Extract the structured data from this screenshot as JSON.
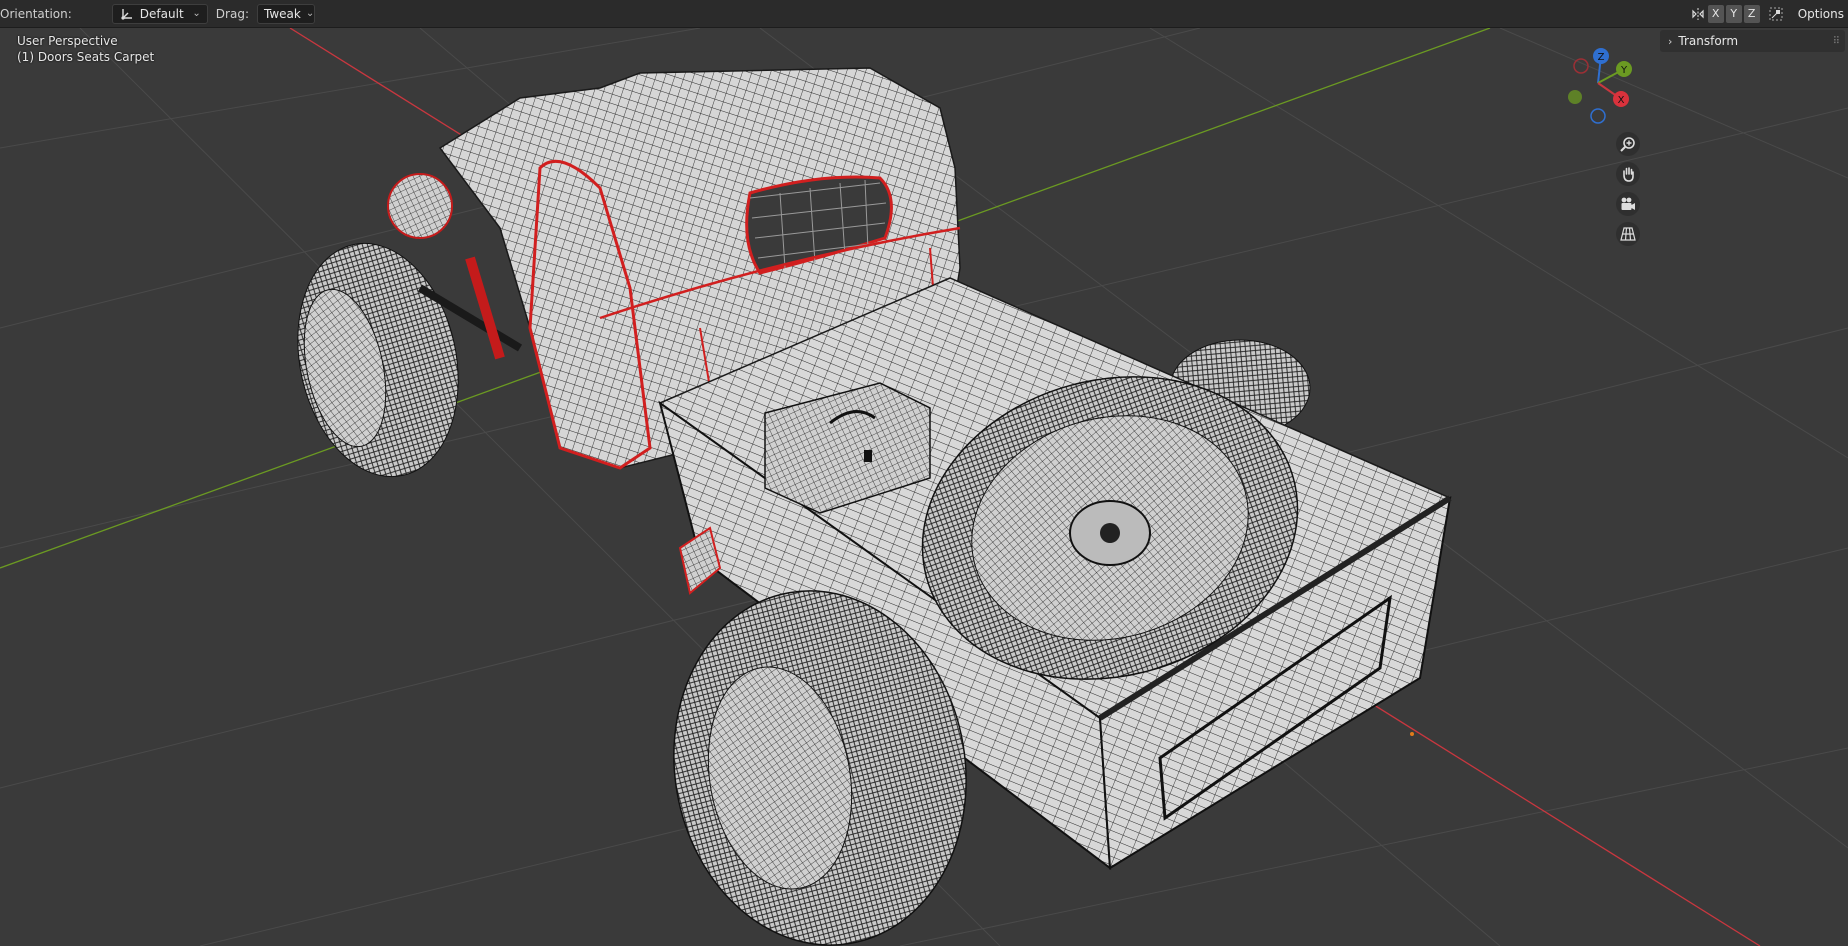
{
  "header": {
    "orientation_label": "Orientation:",
    "orientation_value": "Default",
    "drag_label": "Drag:",
    "drag_value": "Tweak",
    "axis_x": "X",
    "axis_y": "Y",
    "axis_z": "Z",
    "options_label": "Options"
  },
  "viewport": {
    "view_name": "User Perspective",
    "collection_object": "(1) Doors Seats Carpet"
  },
  "gizmo": {
    "z": "Z",
    "y": "Y",
    "x": "X"
  },
  "sidebar": {
    "transform_label": "Transform"
  },
  "icons": {
    "orientation": "transform-orientation-icon",
    "mirror": "mirror-icon",
    "snapping": "snap-icon",
    "zoom": "zoom-icon",
    "pan": "hand-icon",
    "camera": "camera-icon",
    "perspective": "grid-perspective-icon"
  },
  "colors": {
    "viewport_bg": "#3a3a3a",
    "header_bg": "#2b2b2b",
    "axis_x": "#c8373f",
    "axis_y": "#6b9a22",
    "axis_z": "#2f6fd0",
    "wire": "#1a1a1a",
    "seam": "#d11f1f",
    "mesh_face": "#d8d8d8"
  }
}
